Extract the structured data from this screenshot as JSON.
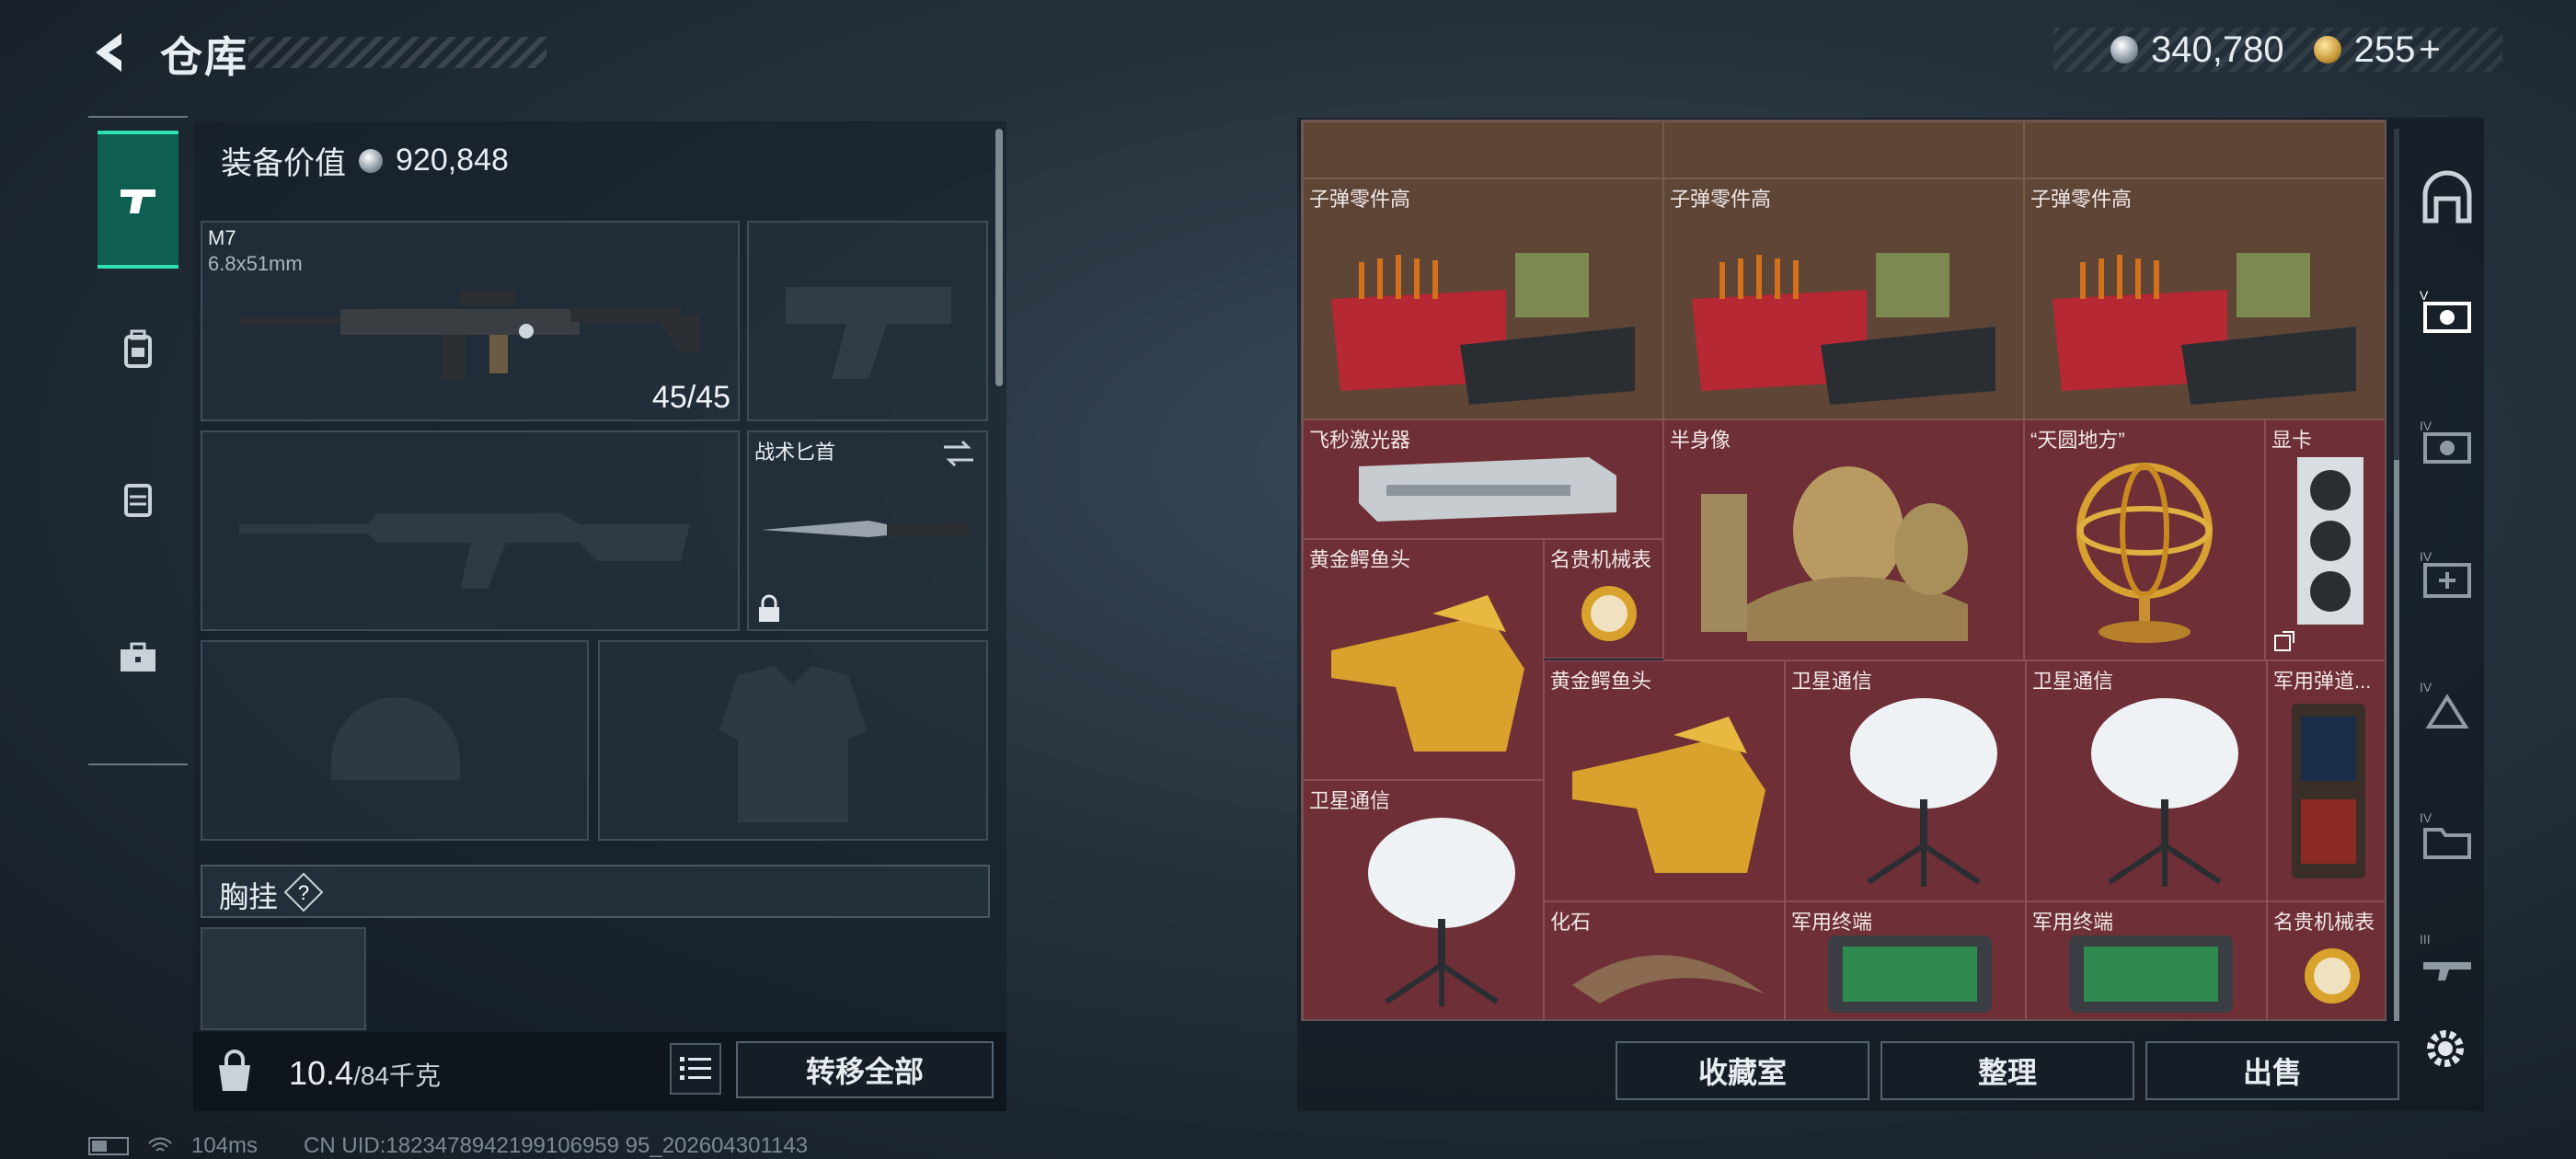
{
  "header": {
    "title": "仓库",
    "silver_amount": "340,780",
    "gold_amount": "255",
    "gold_plus": "+"
  },
  "left_rail": {
    "tabs": [
      "weapon-icon",
      "backpack-icon",
      "vest-icon",
      "toolbox-icon"
    ],
    "active": "weapon-icon"
  },
  "equipment": {
    "value_label": "装备价值",
    "value": "920,848",
    "primary_weapon": {
      "name": "M7",
      "caliber": "6.8x51mm",
      "ammo": "45/45"
    },
    "melee": {
      "name": "战术匕首"
    },
    "chest_rig_label": "胸挂",
    "help_mark": "?"
  },
  "bottom_left": {
    "weight_current": "10.4",
    "weight_capacity": "/84千克",
    "transfer_all_label": "转移全部"
  },
  "stash": {
    "items": [
      {
        "label": "子弹零件高"
      },
      {
        "label": "子弹零件高"
      },
      {
        "label": "子弹零件高"
      },
      {
        "label": "飞秒激光器"
      },
      {
        "label": "半身像"
      },
      {
        "label": "“天圆地方”"
      },
      {
        "label": "显卡"
      },
      {
        "label": "黄金鳄鱼头"
      },
      {
        "label": "名贵机械表"
      },
      {
        "label": "黄金鳄鱼头"
      },
      {
        "label": "卫星通信"
      },
      {
        "label": "卫星通信"
      },
      {
        "label": "军用弹道..."
      },
      {
        "label": "卫星通信"
      },
      {
        "label": "化石"
      },
      {
        "label": "军用终端"
      },
      {
        "label": "军用终端"
      },
      {
        "label": "名贵机械表"
      }
    ],
    "buttons": {
      "collection": "收藏室",
      "organize": "整理",
      "sell": "出售"
    }
  },
  "right_rail": {
    "icons": [
      "home-icon",
      "v-tier-case-icon",
      "iv-tier-case-icon",
      "iv-medkit-icon",
      "iv-ammo-icon",
      "iv-folder-icon",
      "iii-rifle-icon"
    ]
  },
  "status": {
    "ping": "104ms",
    "uid": "CN UID:1823478942199106959 95_202604301143"
  },
  "colors": {
    "accent": "#2ee0b5",
    "item_bg": "#6e2f36",
    "panel_bg": "#14202a"
  }
}
